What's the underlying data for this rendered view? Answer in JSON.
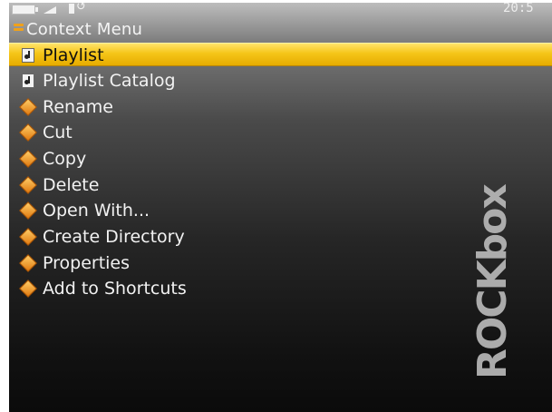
{
  "statusbar": {
    "time": "20:5",
    "battery_icon": "battery-icon",
    "volume_icon": "volume-icon",
    "hold_icon": "hold-icon",
    "repeat_icon": "repeat-icon"
  },
  "header": {
    "title": "Context Menu",
    "icon": "menu-list-icon"
  },
  "menu": {
    "items": [
      {
        "label": "Playlist",
        "icon": "playlist-icon",
        "selected": true
      },
      {
        "label": "Playlist Catalog",
        "icon": "playlist-icon",
        "selected": false
      },
      {
        "label": "Rename",
        "icon": "diamond-bullet-icon",
        "selected": false
      },
      {
        "label": "Cut",
        "icon": "diamond-bullet-icon",
        "selected": false
      },
      {
        "label": "Copy",
        "icon": "diamond-bullet-icon",
        "selected": false
      },
      {
        "label": "Delete",
        "icon": "diamond-bullet-icon",
        "selected": false
      },
      {
        "label": "Open With...",
        "icon": "diamond-bullet-icon",
        "selected": false
      },
      {
        "label": "Create Directory",
        "icon": "diamond-bullet-icon",
        "selected": false
      },
      {
        "label": "Properties",
        "icon": "diamond-bullet-icon",
        "selected": false
      },
      {
        "label": "Add to Shortcuts",
        "icon": "diamond-bullet-icon",
        "selected": false
      }
    ]
  },
  "logo": {
    "text": "ROCKbox"
  },
  "colors": {
    "accent": "#f5c518",
    "background_top": "#bdbdbd",
    "background_bottom": "#0b0b0b",
    "text": "#f2f2f2",
    "bullet": "#f0a11a"
  }
}
